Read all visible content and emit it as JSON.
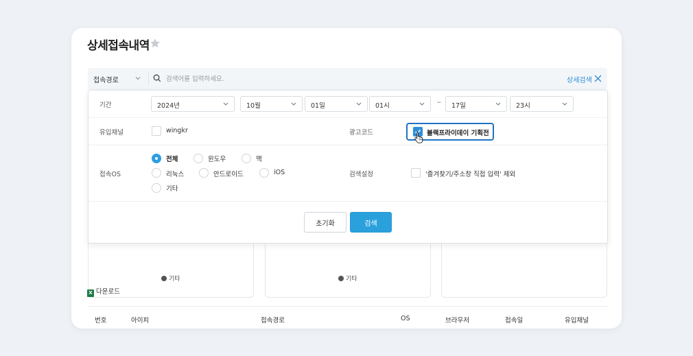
{
  "page": {
    "title": "상세접속내역"
  },
  "search": {
    "type_value": "접속경로",
    "placeholder": "검색어를 입력하세요.",
    "advanced_label": "상세검색"
  },
  "filters": {
    "period": {
      "label": "기간",
      "year": "2024년",
      "month": "10월",
      "start_day": "01일",
      "start_hour": "01시",
      "separator": "~",
      "end_day": "17일",
      "end_hour": "23시"
    },
    "channel": {
      "label": "유입채널",
      "option": "wingkr",
      "checked": false
    },
    "ad_code": {
      "label": "광고코드",
      "option": "블랙프라이데이 기획전",
      "checked": true
    },
    "os": {
      "label": "접속OS",
      "options": [
        "전체",
        "윈도우",
        "맥",
        "리눅스",
        "안드로이드",
        "iOS",
        "기타"
      ],
      "selected": "전체"
    },
    "search_setting": {
      "label": "검색설정",
      "option": "'즐겨찾기/주소창 직접 입력' 제외",
      "checked": false
    }
  },
  "buttons": {
    "reset": "초기화",
    "search": "검색"
  },
  "summary_cards": [
    {
      "legend": "기타"
    },
    {
      "legend": "기타"
    },
    {
      "legend": ""
    }
  ],
  "download": {
    "label": "다운로드",
    "icon_letter": "X"
  },
  "table": {
    "headers": [
      "번호",
      "아이피",
      "접속경로",
      "OS",
      "브라우저",
      "접속일",
      "유입채널"
    ]
  },
  "colors": {
    "accent": "#2aa1dc",
    "highlight_border": "#1f73c2",
    "background": "#eef1f5"
  }
}
